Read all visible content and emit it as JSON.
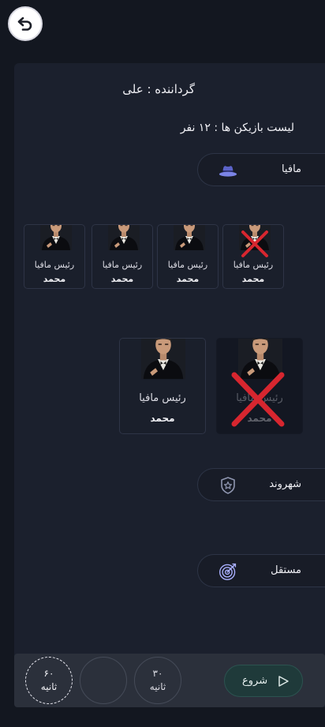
{
  "header": {
    "back_icon": "undo-arrow-icon",
    "narrator_text": "گرداننده : علی",
    "players_count_text": "لیست بازیکن ها : ۱۲ نفر"
  },
  "teams": {
    "mafia": {
      "label": "مافیا",
      "icon": "fedora-hat-icon"
    },
    "citizen": {
      "label": "شهروند",
      "icon": "police-badge-icon"
    },
    "independent": {
      "label": "مستقل",
      "icon": "target-icon"
    }
  },
  "mafia_players_row1": [
    {
      "role": "رئیس مافیا",
      "name": "محمد",
      "eliminated": false
    },
    {
      "role": "رئیس مافیا",
      "name": "محمد",
      "eliminated": false
    },
    {
      "role": "رئیس مافیا",
      "name": "محمد",
      "eliminated": false
    },
    {
      "role": "رئیس مافیا",
      "name": "محمد",
      "eliminated": true
    }
  ],
  "mafia_players_row2": [
    {
      "role": "رئیس مافیا",
      "name": "محمد",
      "eliminated": false
    },
    {
      "role": "رئیس مافیا",
      "name": "محمد",
      "eliminated": true
    }
  ],
  "bottom_bar": {
    "timer_60": {
      "value": "۶۰",
      "unit": "ثانیه",
      "selected": true
    },
    "timer_empty": {
      "value": "",
      "unit": ""
    },
    "timer_30": {
      "value": "۳۰",
      "unit": "ثانیه",
      "selected": false
    },
    "start_label": "شروع"
  },
  "colors": {
    "background": "#131720",
    "panel": "#1b202d",
    "eliminated_mark": "#d7262f",
    "start_button": "#1f3a3a"
  }
}
